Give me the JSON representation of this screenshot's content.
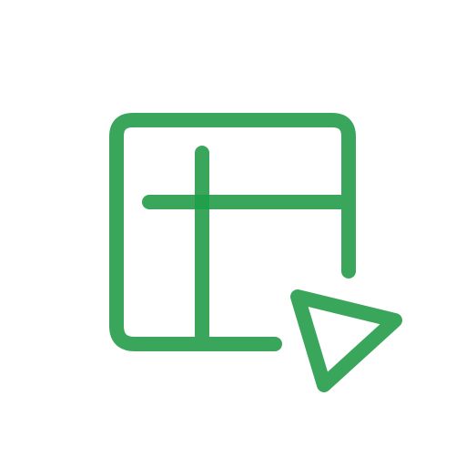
{
  "icon": {
    "name": "table-select-icon",
    "colors": {
      "stroke": "#3aa65c",
      "overlap": "#0a9a3a",
      "background": "#ffffff"
    }
  }
}
